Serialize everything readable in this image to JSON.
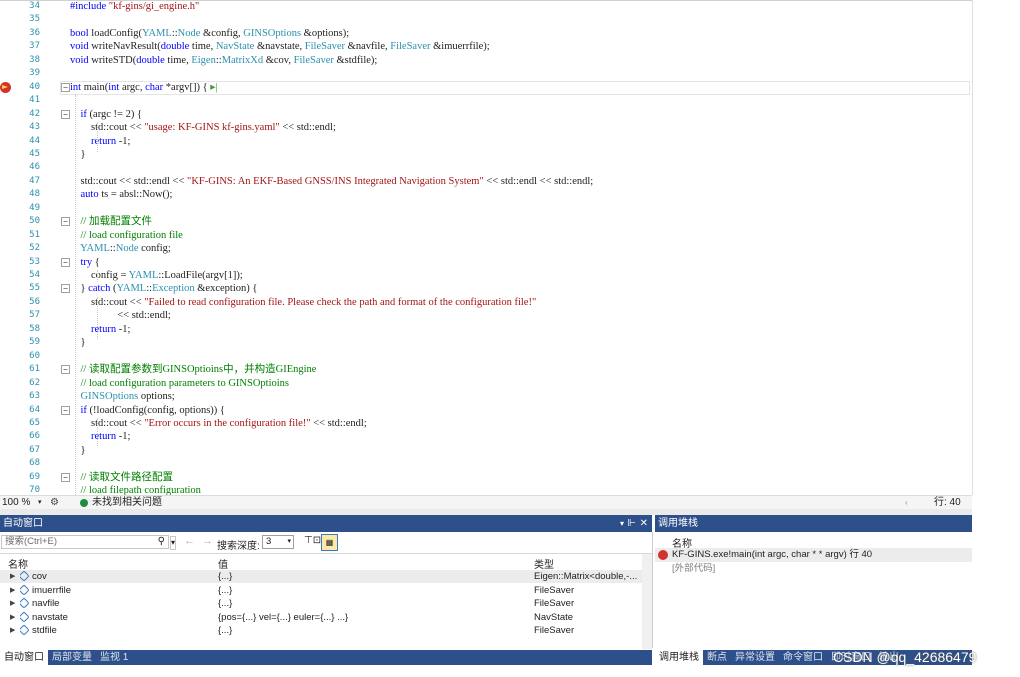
{
  "editor": {
    "lines": [
      {
        "n": "34",
        "html": "<span class='kw'>#include</span> <span class='str'>\"kf-gins/gi_engine.h\"</span>",
        "fold": ""
      },
      {
        "n": "35",
        "html": "",
        "fold": ""
      },
      {
        "n": "36",
        "html": "<span class='kw'>bool</span> loadConfig(<span class='ty'>YAML</span>::<span class='ty'>Node</span> &amp;config, <span class='ty'>GINSOptions</span> &amp;options);",
        "fold": ""
      },
      {
        "n": "37",
        "html": "<span class='kw'>void</span> writeNavResult(<span class='kw'>double</span> time, <span class='ty'>NavState</span> &amp;navstate, <span class='ty'>FileSaver</span> &amp;navfile, <span class='ty'>FileSaver</span> &amp;imuerrfile);",
        "fold": ""
      },
      {
        "n": "38",
        "html": "<span class='kw'>void</span> writeSTD(<span class='kw'>double</span> time, <span class='ty'>Eigen</span>::<span class='ty'>MatrixXd</span> &amp;cov, <span class='ty'>FileSaver</span> &amp;stdfile);",
        "fold": ""
      },
      {
        "n": "39",
        "html": "",
        "fold": ""
      },
      {
        "n": "40",
        "html": "<span class='kw'>int</span> main(<span class='kw'>int</span> argc, <span class='kw'>char</span> *argv[]) { <span style='color:#3c9b3c'>▸|</span>",
        "fold": "−"
      },
      {
        "n": "41",
        "html": "",
        "fold": ""
      },
      {
        "n": "42",
        "html": "    <span class='kw'>if</span> (argc != 2) {",
        "fold": "−"
      },
      {
        "n": "43",
        "html": "        std::cout &lt;&lt; <span class='str'>\"usage: KF-GINS kf-gins.yaml\"</span> &lt;&lt; std::endl;",
        "fold": ""
      },
      {
        "n": "44",
        "html": "        <span class='kw'>return</span> -1;",
        "fold": ""
      },
      {
        "n": "45",
        "html": "    }",
        "fold": ""
      },
      {
        "n": "46",
        "html": "",
        "fold": ""
      },
      {
        "n": "47",
        "html": "    std::cout &lt;&lt; std::endl &lt;&lt; <span class='str'>\"KF-GINS: An EKF-Based GNSS/INS Integrated Navigation System\"</span> &lt;&lt; std::endl &lt;&lt; std::endl;",
        "fold": ""
      },
      {
        "n": "48",
        "html": "    <span class='kw'>auto</span> ts = absl::Now();",
        "fold": ""
      },
      {
        "n": "49",
        "html": "",
        "fold": ""
      },
      {
        "n": "50",
        "html": "    <span class='cm'>// 加载配置文件</span>",
        "fold": "−"
      },
      {
        "n": "51",
        "html": "    <span class='cm'>// load configuration file</span>",
        "fold": ""
      },
      {
        "n": "52",
        "html": "    <span class='ty'>YAML</span>::<span class='ty'>Node</span> config;",
        "fold": ""
      },
      {
        "n": "53",
        "html": "    <span class='kw'>try</span> {",
        "fold": "−"
      },
      {
        "n": "54",
        "html": "        config = <span class='ty'>YAML</span>::LoadFile(argv[1]);",
        "fold": ""
      },
      {
        "n": "55",
        "html": "    } <span class='kw'>catch</span> (<span class='ty'>YAML</span>::<span class='ty'>Exception</span> &amp;exception) {",
        "fold": "−"
      },
      {
        "n": "56",
        "html": "        std::cout &lt;&lt; <span class='str'>\"Failed to read configuration file. Please check the path and format of the configuration file!\"</span>",
        "fold": ""
      },
      {
        "n": "57",
        "html": "                  &lt;&lt; std::endl;",
        "fold": ""
      },
      {
        "n": "58",
        "html": "        <span class='kw'>return</span> -1;",
        "fold": ""
      },
      {
        "n": "59",
        "html": "    }",
        "fold": ""
      },
      {
        "n": "60",
        "html": "",
        "fold": ""
      },
      {
        "n": "61",
        "html": "    <span class='cm'>// 读取配置参数到GINSOptioins中，并构造GIEngine</span>",
        "fold": "−"
      },
      {
        "n": "62",
        "html": "    <span class='cm'>// load configuration parameters to GINSOptioins</span>",
        "fold": ""
      },
      {
        "n": "63",
        "html": "    <span class='ty'>GINSOptions</span> options;",
        "fold": ""
      },
      {
        "n": "64",
        "html": "    <span class='kw'>if</span> (!loadConfig(config, options)) {",
        "fold": "−"
      },
      {
        "n": "65",
        "html": "        std::cout &lt;&lt; <span class='str'>\"Error occurs in the configuration file!\"</span> &lt;&lt; std::endl;",
        "fold": ""
      },
      {
        "n": "66",
        "html": "        <span class='kw'>return</span> -1;",
        "fold": ""
      },
      {
        "n": "67",
        "html": "    }",
        "fold": ""
      },
      {
        "n": "68",
        "html": "",
        "fold": ""
      },
      {
        "n": "69",
        "html": "    <span class='cm'>// 读取文件路径配置</span>",
        "fold": "−"
      },
      {
        "n": "70",
        "html": "    <span class='cm'>// load filepath configuration</span>",
        "fold": ""
      }
    ]
  },
  "status": {
    "zoom": "100 %",
    "issues": "未找到相关问题",
    "line": "行: 40"
  },
  "autos": {
    "title": "自动窗口",
    "search_placeholder": "搜索(Ctrl+E)",
    "search_depth_label": "搜索深度:",
    "search_depth_value": "3",
    "columns": {
      "name": "名称",
      "value": "值",
      "type": "类型"
    },
    "rows": [
      {
        "name": "cov",
        "value": "{...}",
        "type": "Eigen::Matrix<double,-..."
      },
      {
        "name": "imuerrfile",
        "value": "{...}",
        "type": "FileSaver"
      },
      {
        "name": "navfile",
        "value": "{...}",
        "type": "FileSaver"
      },
      {
        "name": "navstate",
        "value": "{pos={...} vel={...} euler={...} ...}",
        "type": "NavState"
      },
      {
        "name": "stdfile",
        "value": "{...}",
        "type": "FileSaver"
      }
    ]
  },
  "stack": {
    "title": "调用堆栈",
    "column": "名称",
    "frames": [
      {
        "text": "KF-GINS.exe!main(int argc, char * * argv) 行 40"
      },
      {
        "text": "[外部代码]"
      }
    ]
  },
  "tabs_left": [
    "自动窗口",
    "局部变量",
    "监视 1"
  ],
  "tabs_right": [
    "调用堆栈",
    "断点",
    "异常设置",
    "命令窗口",
    "即时窗口",
    "输出"
  ],
  "watermark": "CSDN @qq_42686479"
}
